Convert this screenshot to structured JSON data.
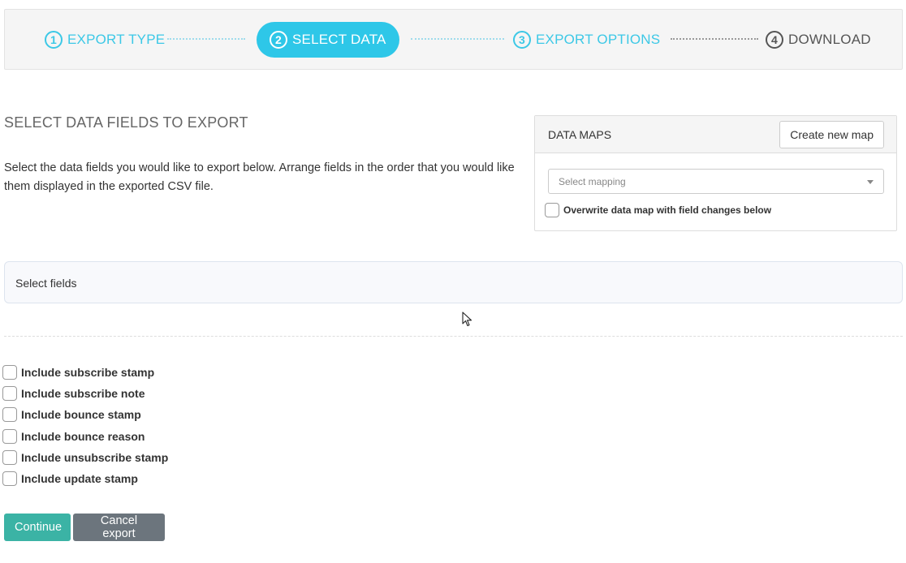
{
  "wizard": {
    "steps": [
      {
        "num": "1",
        "label": "EXPORT TYPE",
        "state": "done"
      },
      {
        "num": "2",
        "label": "SELECT DATA",
        "state": "active"
      },
      {
        "num": "3",
        "label": "EXPORT OPTIONS",
        "state": "done"
      },
      {
        "num": "4",
        "label": "DOWNLOAD",
        "state": "pending"
      }
    ]
  },
  "intro": {
    "title": "SELECT DATA FIELDS TO EXPORT",
    "description": "Select the data fields you would like to export below. Arrange fields in the order that you would like them displayed in the exported CSV file."
  },
  "data_maps": {
    "title": "DATA MAPS",
    "create_button": "Create new map",
    "select_placeholder": "Select mapping",
    "overwrite_label": "Overwrite data map with field changes below",
    "overwrite_checked": false
  },
  "fields": {
    "label": "Select fields"
  },
  "options": [
    {
      "label": "Include subscribe stamp",
      "checked": false
    },
    {
      "label": "Include subscribe note",
      "checked": false
    },
    {
      "label": "Include bounce stamp",
      "checked": false
    },
    {
      "label": "Include bounce reason",
      "checked": false
    },
    {
      "label": "Include unsubscribe stamp",
      "checked": false
    },
    {
      "label": "Include update stamp",
      "checked": false
    }
  ],
  "actions": {
    "continue": "Continue",
    "cancel": "Cancel export"
  },
  "colors": {
    "step_accent": "#2ec7e8",
    "continue_bg": "#3bb3a5",
    "cancel_bg": "#6c757d"
  }
}
